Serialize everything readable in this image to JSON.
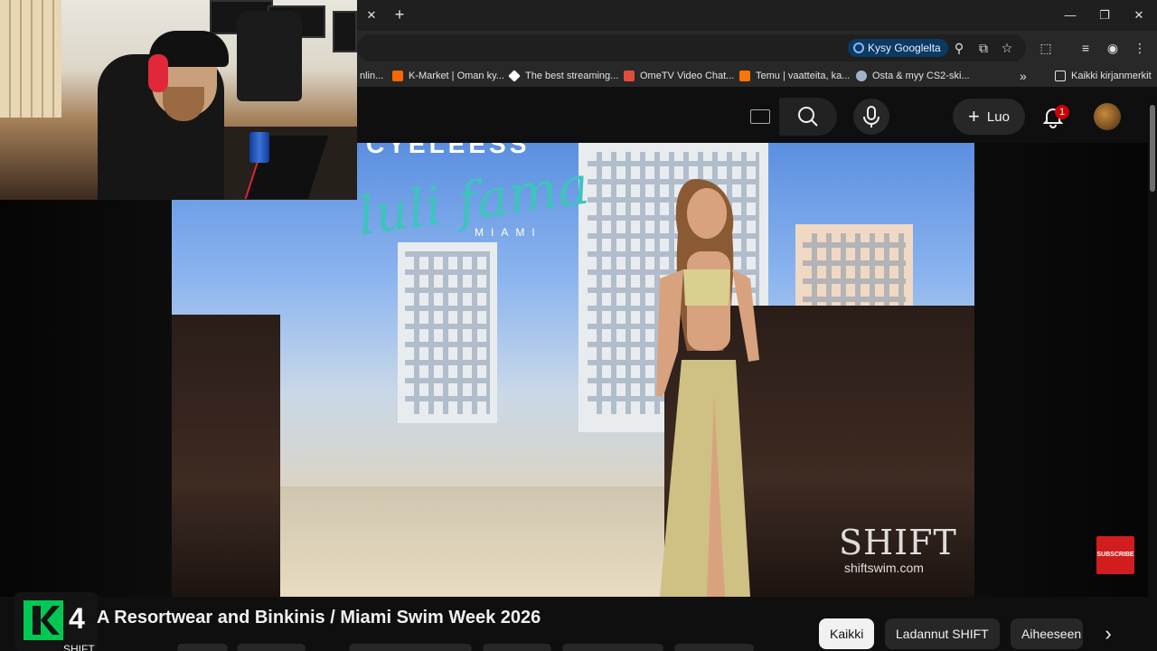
{
  "browser": {
    "ask_google_label": "Kysy Googlelta",
    "bookmarks": [
      {
        "label": "nlin...",
        "icon": "cut-off"
      },
      {
        "label": "K-Market | Oman ky...",
        "icon": "k-market",
        "color": "#ff6600"
      },
      {
        "label": "The best streaming...",
        "icon": "diamond"
      },
      {
        "label": "OmeTV Video Chat...",
        "icon": "chat",
        "color": "#e24c3d"
      },
      {
        "label": "Temu | vaatteita, ka...",
        "icon": "temu",
        "color": "#fb7701"
      },
      {
        "label": "Osta & myy CS2-ski...",
        "icon": "cloud"
      }
    ],
    "bookmarks_more": "»",
    "all_bookmarks_label": "Kaikki kirjanmerkit"
  },
  "youtube": {
    "create_label": "Luo",
    "notification_count": "1"
  },
  "video": {
    "overlay_brand_top": "CYELEESS",
    "overlay_brand_script": "luli fama",
    "overlay_brand_sub": "MIAMI",
    "watermark": "SHIFT",
    "watermark_url": "shiftswim.com",
    "subscribe_badge": "SUBSCRIBE"
  },
  "channel_logo_number": "4",
  "title": "A Resortwear and Binkinis / Miami Swim Week 2026",
  "channel_name_stub": "SHIFT",
  "chips": [
    {
      "label": "Kaikki",
      "active": true
    },
    {
      "label": "Ladannut SHIFT",
      "active": false
    },
    {
      "label": "Aiheeseen",
      "active": false
    }
  ],
  "colors": {
    "background": "#0f0f0f",
    "accent_red": "#cc0000",
    "chip_active": "#f1f1f1",
    "k_logo_green": "#00c853"
  }
}
